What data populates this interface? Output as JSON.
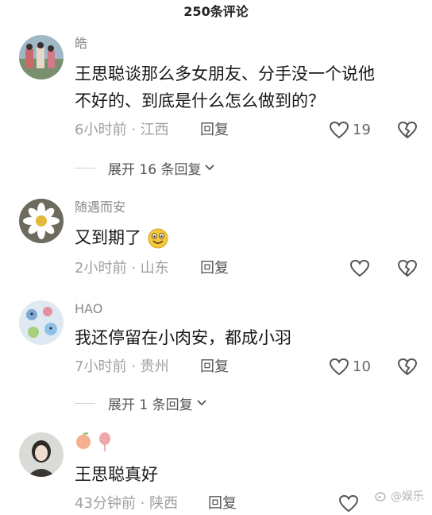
{
  "header": {
    "title": "250条评论"
  },
  "comments": [
    {
      "username": "皓",
      "text_line1": "王思聪谈那么多女朋友、分手没一个说他",
      "text_line2": "不好的、到底是什么怎么做到的？",
      "time": "6小时前",
      "location": "江西",
      "reply_label": "回复",
      "likes": "19",
      "expand_label": "展开 16 条回复"
    },
    {
      "username": "随遇而安",
      "text": "又到期了",
      "time": "2小时前",
      "location": "山东",
      "reply_label": "回复"
    },
    {
      "username": "HAO",
      "text": "我还停留在小肉安，都成小羽",
      "time": "7小时前",
      "location": "贵州",
      "reply_label": "回复",
      "likes": "10",
      "expand_label": "展开 1 条回复"
    },
    {
      "text": "王思聪真好",
      "time": "43分钟前",
      "location": "陕西",
      "reply_label": "回复"
    }
  ],
  "separator": "·",
  "watermark": "@娱乐",
  "colors": {
    "text": "#161616",
    "meta": "#a0a0a0",
    "like_icon": "#555555"
  },
  "icons": {
    "like": "heart-outline-icon",
    "dislike": "broken-heart-icon",
    "expand": "chevron-down-icon",
    "emoji": "grinning-face-icon"
  }
}
